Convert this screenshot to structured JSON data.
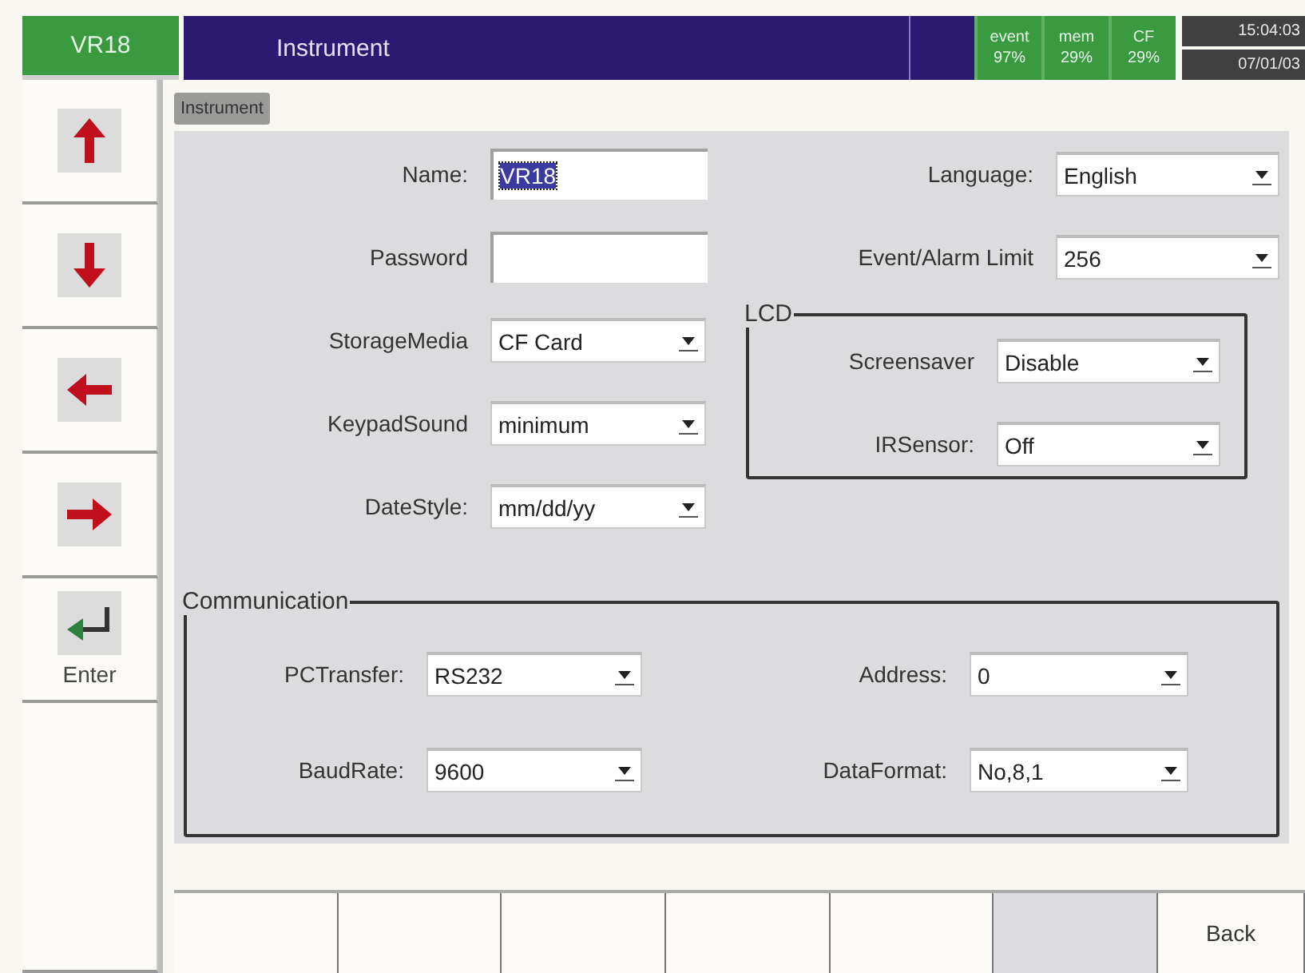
{
  "header": {
    "device": "VR18",
    "title": "Instrument",
    "stats": [
      {
        "label": "event",
        "value": "97%"
      },
      {
        "label": "mem",
        "value": "29%"
      },
      {
        "label": "CF",
        "value": "29%"
      }
    ],
    "time": "15:04:03",
    "date": "07/01/03"
  },
  "sidebar": [
    {
      "kind": "up"
    },
    {
      "kind": "down"
    },
    {
      "kind": "left"
    },
    {
      "kind": "right"
    },
    {
      "kind": "enter",
      "label": "Enter"
    },
    {
      "kind": "blank"
    }
  ],
  "tab": "Instrument",
  "left_fields": [
    {
      "label": "Name:",
      "kind": "text",
      "value": "VR18",
      "text_selected": true
    },
    {
      "label": "Password",
      "kind": "text"
    },
    {
      "label": "StorageMedia",
      "kind": "select",
      "value": "CF Card"
    },
    {
      "label": "KeypadSound",
      "kind": "select",
      "value": "minimum"
    },
    {
      "label": "DateStyle:",
      "kind": "select",
      "value": "mm/dd/yy"
    }
  ],
  "right_fields": [
    {
      "label": "Language:",
      "kind": "select",
      "value": "English"
    },
    {
      "label": "Event/Alarm Limit",
      "kind": "select",
      "value": "256"
    }
  ],
  "lcd": {
    "title": "LCD",
    "fields": [
      {
        "label": "Screensaver",
        "kind": "select",
        "value": "Disable"
      },
      {
        "label": "IRSensor:",
        "kind": "select",
        "value": "Off"
      }
    ]
  },
  "communication": {
    "title": "Communication",
    "fields": [
      {
        "label": "PCTransfer:",
        "kind": "select",
        "value": "RS232"
      },
      {
        "label": "Address:",
        "kind": "select",
        "value": "0"
      },
      {
        "label": "BaudRate:",
        "kind": "select",
        "value": "9600"
      },
      {
        "label": "DataFormat:",
        "kind": "select",
        "value": "No,8,1"
      }
    ]
  },
  "softkeys": [
    {
      "kind": "blank",
      "shaded": false
    },
    {
      "kind": "blank",
      "shaded": false
    },
    {
      "kind": "blank",
      "shaded": false
    },
    {
      "kind": "blank",
      "shaded": false
    },
    {
      "kind": "blank",
      "shaded": false
    },
    {
      "kind": "blank",
      "shaded": true
    },
    {
      "kind": "label",
      "label": "Back",
      "shaded": false
    }
  ]
}
